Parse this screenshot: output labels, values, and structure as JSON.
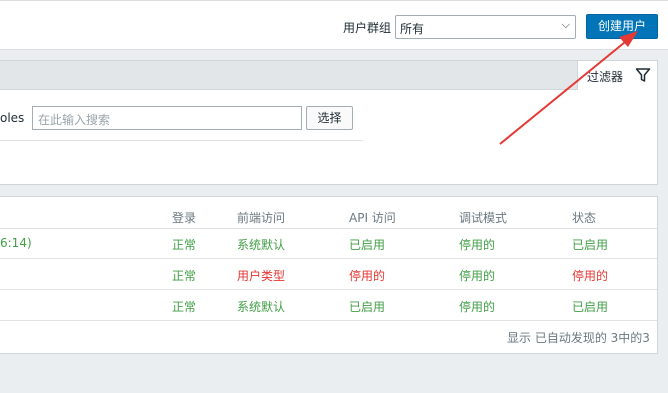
{
  "header": {
    "group_label": "用户群组",
    "group_value": "所有",
    "create_button": "创建用户"
  },
  "filter": {
    "tab_label": "过滤器",
    "roles_label": "oles",
    "search_placeholder": "在此输入搜索",
    "select_button": "选择"
  },
  "table": {
    "headers": [
      "登录",
      "前端访问",
      "API 访问",
      "调试模式",
      "状态"
    ],
    "rows": [
      {
        "prefix": "6:14)",
        "login": "正常",
        "frontend": "系统默认",
        "api": "已启用",
        "debug": "停用的",
        "status": "已启用"
      },
      {
        "prefix": "",
        "login": "正常",
        "frontend": "用户类型",
        "api": "停用的",
        "debug": "停用的",
        "status": "停用的"
      },
      {
        "prefix": "",
        "login": "正常",
        "frontend": "系统默认",
        "api": "已启用",
        "debug": "停用的",
        "status": "已启用"
      }
    ],
    "footer": "显示 已自动发现的 3中的3"
  },
  "colors": {
    "accent": "#0275b8",
    "enabled": "#429e47",
    "disabled": "#e33734",
    "annotation_arrow": "#e53935"
  },
  "icons": [
    "chevron-down-icon",
    "filter-icon"
  ]
}
